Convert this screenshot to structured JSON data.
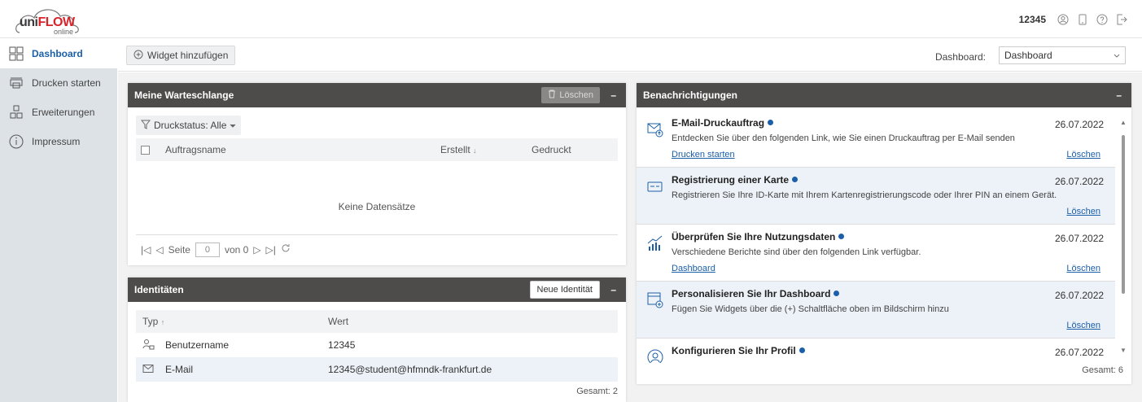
{
  "brand": {
    "logo_a": "uni",
    "logo_b": "FLOW",
    "logo_sub": "online"
  },
  "topbar": {
    "user": "12345",
    "icons": [
      "account-icon",
      "phone-icon",
      "help-icon",
      "logout-icon"
    ]
  },
  "sidebar": {
    "items": [
      {
        "label": "Dashboard",
        "icon": "dashboard-icon",
        "active": true
      },
      {
        "label": "Drucken starten",
        "icon": "printer-icon",
        "active": false
      },
      {
        "label": "Erweiterungen",
        "icon": "extensions-icon",
        "active": false
      },
      {
        "label": "Impressum",
        "icon": "info-icon",
        "active": false
      }
    ]
  },
  "toolbar": {
    "add_widget": "Widget hinzufügen",
    "dashboard_label": "Dashboard:",
    "dashboard_value": "Dashboard"
  },
  "queue": {
    "title": "Meine Warteschlange",
    "delete_label": "Löschen",
    "filter_label": "Druckstatus: Alle",
    "columns": [
      "Auftragsname",
      "Erstellt",
      "Gedruckt"
    ],
    "empty": "Keine Datensätze",
    "pager": {
      "page_label": "Seite",
      "page_value": "0",
      "of_label": "von 0"
    }
  },
  "identities": {
    "title": "Identitäten",
    "new_label": "Neue Identität",
    "col_type": "Typ",
    "col_value": "Wert",
    "rows": [
      {
        "type": "Benutzername",
        "value": "12345"
      },
      {
        "type": "E-Mail",
        "value": "12345@student@hfmndk-frankfurt.de"
      }
    ],
    "total": "Gesamt: 2"
  },
  "notifications": {
    "title": "Benachrichtigungen",
    "total": "Gesamt: 6",
    "items": [
      {
        "title": "E-Mail-Druckauftrag",
        "date": "26.07.2022",
        "desc": "Entdecken Sie über den folgenden Link, wie Sie einen Druckauftrag per E-Mail senden",
        "link": "Drucken starten",
        "delete": "Löschen"
      },
      {
        "title": "Registrierung einer Karte",
        "date": "26.07.2022",
        "desc": "Registrieren Sie Ihre ID-Karte mit Ihrem Kartenregistrierungscode oder Ihrer PIN an einem Gerät.",
        "link": "",
        "delete": "Löschen"
      },
      {
        "title": "Überprüfen Sie Ihre Nutzungsdaten",
        "date": "26.07.2022",
        "desc": "Verschiedene Berichte sind über den folgenden Link verfügbar.",
        "link": "Dashboard",
        "delete": "Löschen"
      },
      {
        "title": "Personalisieren Sie Ihr Dashboard",
        "date": "26.07.2022",
        "desc": "Fügen Sie Widgets über die (+) Schaltfläche oben im Bildschirm hinzu",
        "link": "",
        "delete": "Löschen"
      },
      {
        "title": "Konfigurieren Sie Ihr Profil",
        "date": "26.07.2022",
        "desc": "",
        "link": "",
        "delete": ""
      }
    ]
  },
  "colors": {
    "header": "#4e4b4b",
    "accent": "#1a5fa8",
    "sidebar": "#dde2e7",
    "logo_red": "#d8232a"
  }
}
